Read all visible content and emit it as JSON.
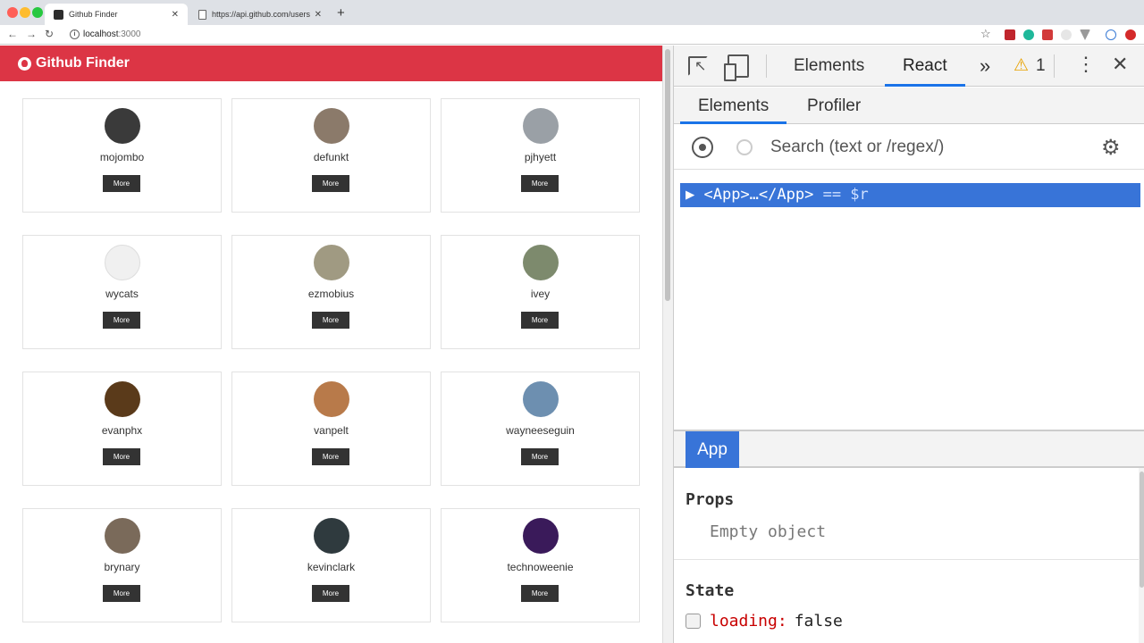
{
  "browser": {
    "tabs": [
      {
        "title": "Github Finder",
        "active": true
      },
      {
        "title": "https://api.github.com/users",
        "active": false
      }
    ],
    "close_glyph": "✕",
    "new_tab_glyph": "+",
    "address": {
      "host": "localhost",
      "port": ":3000"
    },
    "info_glyph": "i",
    "star_glyph": "☆",
    "back_glyph": "←",
    "forward_glyph": "→",
    "reload_glyph": "↻"
  },
  "app": {
    "brand": "Github Finder",
    "more_label": "More",
    "users": [
      {
        "login": "mojombo",
        "color": "#3a3a3a"
      },
      {
        "login": "defunkt",
        "color": "#8b7a6a"
      },
      {
        "login": "pjhyett",
        "color": "#9aa0a6"
      },
      {
        "login": "wycats",
        "color": "#f0f0f0"
      },
      {
        "login": "ezmobius",
        "color": "#a09a82"
      },
      {
        "login": "ivey",
        "color": "#7d8a6d"
      },
      {
        "login": "evanphx",
        "color": "#5a3a1a"
      },
      {
        "login": "vanpelt",
        "color": "#b87a4a"
      },
      {
        "login": "wayneeseguin",
        "color": "#6d8fb0"
      },
      {
        "login": "brynary",
        "color": "#7a6a5a"
      },
      {
        "login": "kevinclark",
        "color": "#2f3a3e"
      },
      {
        "login": "technoweenie",
        "color": "#3a1a5a"
      }
    ],
    "colors": {
      "navbar": "#dc3545",
      "button": "#333333"
    }
  },
  "devtools": {
    "tabs": {
      "elements": "Elements",
      "react": "React"
    },
    "chevrons": "»",
    "warning_glyph": "⚠",
    "warning_count": "1",
    "kebab_glyph": "⋮",
    "close_glyph": "✕",
    "subtabs": {
      "elements": "Elements",
      "profiler": "Profiler"
    },
    "search": {
      "placeholder": "Search (text or /regex/)"
    },
    "gear_glyph": "⚙",
    "tree": {
      "arrow": "▶",
      "node": "<App>…</App>",
      "eq": "== $r"
    },
    "selected_component": "App",
    "props": {
      "heading": "Props",
      "empty": "Empty object"
    },
    "state": {
      "heading": "State",
      "key": "loading:",
      "value": "false"
    },
    "colors": {
      "accent": "#3874d8",
      "tab_underline": "#1a73e8",
      "warning": "#e8a200",
      "state_key": "#c80000"
    }
  }
}
